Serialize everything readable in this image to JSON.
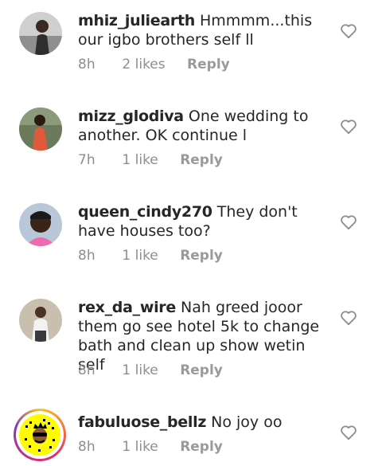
{
  "comments": [
    {
      "username": "mhiz_juliearth",
      "text": "Hmmmm...this our igbo brothers self ll",
      "time": "8h",
      "likes": "2 likes",
      "reply": "Reply",
      "avatar": "person-icon"
    },
    {
      "username": "mizz_glodiva",
      "text": "One wedding to another. OK continue l",
      "time": "7h",
      "likes": "1 like",
      "reply": "Reply",
      "avatar": "person-icon"
    },
    {
      "username": "queen_cindy270",
      "text": "They don't have houses too?",
      "time": "8h",
      "likes": "1 like",
      "reply": "Reply",
      "avatar": "person-icon"
    },
    {
      "username": "rex_da_wire",
      "text": "Nah greed jooor them go see hotel 5k to change bath and clean up show wetin self",
      "time": "8h",
      "likes": "1 like",
      "reply": "Reply",
      "avatar": "person-icon"
    },
    {
      "username": "fabuluose_bellz",
      "text": "No joy oo",
      "time": "8h",
      "likes": "1 like",
      "reply": "Reply",
      "avatar": "snapcode-icon"
    }
  ],
  "colors": {
    "primary_text": "#262626",
    "secondary_text": "#8e8e8e",
    "heart_outline": "#8e8e8e",
    "snap_yellow": "#fffc00"
  },
  "icons": {
    "like": "heart-outline-icon"
  }
}
